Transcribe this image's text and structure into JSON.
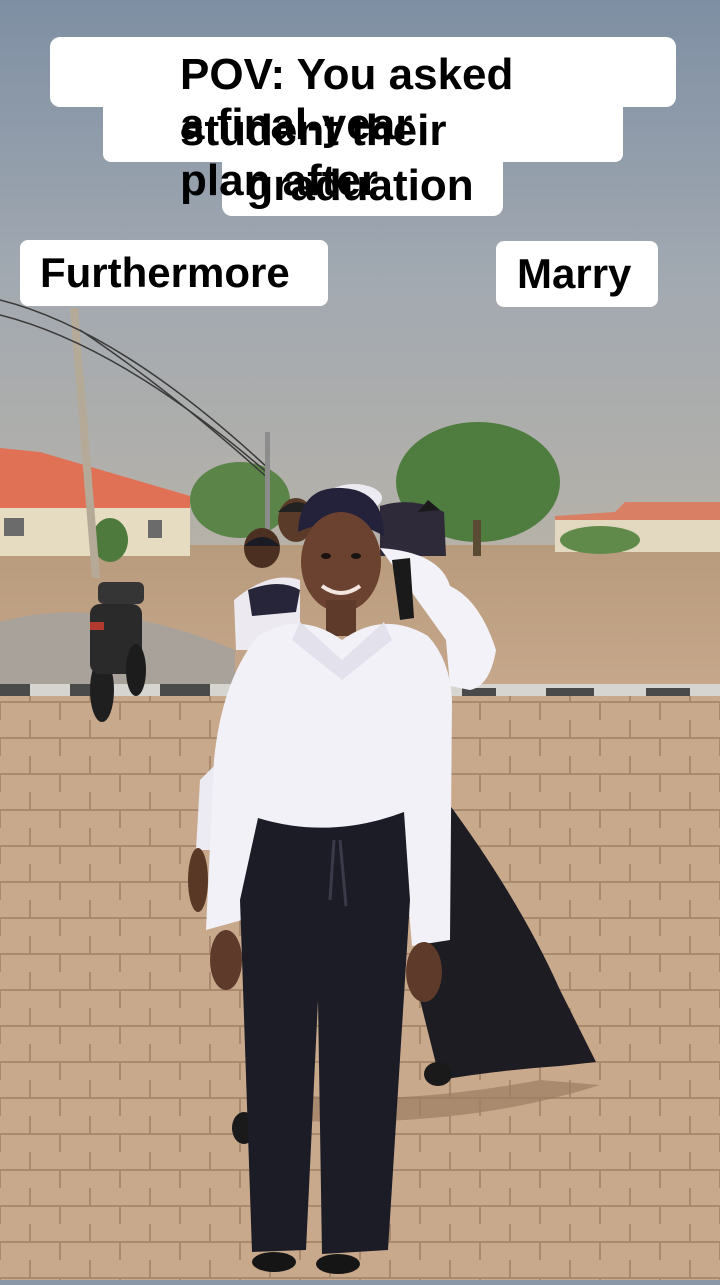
{
  "caption": {
    "lines": [
      "POV: You asked a final-year",
      "student their plan after",
      "graduation"
    ]
  },
  "labels": {
    "left": "Furthermore",
    "right": "Marry"
  }
}
